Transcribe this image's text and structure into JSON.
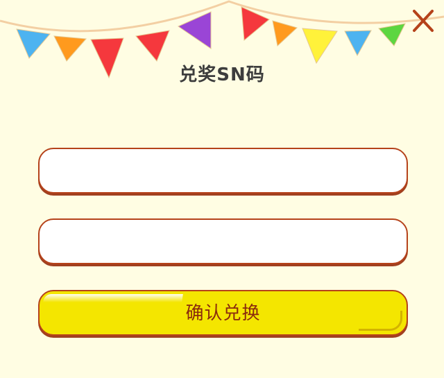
{
  "dialog": {
    "title": "兑奖SN码",
    "fields": [
      {
        "value": "",
        "placeholder": ""
      },
      {
        "value": "",
        "placeholder": ""
      }
    ],
    "confirm_label": "确认兑换",
    "close_icon": "close-icon"
  },
  "colors": {
    "background": "#fffde3",
    "border": "#b5421a",
    "button_fill": "#f4e600",
    "button_text": "#8a2a0d",
    "title_text": "#3d3d3d",
    "close_icon": "#b5421a"
  },
  "bunting": {
    "flag_colors": [
      "#4db3f0",
      "#ff9a1e",
      "#f5383d",
      "#f5383d",
      "#9a45d6",
      "#f5383d",
      "#ff9a1e",
      "#fff23a",
      "#4db3f0",
      "#5dd640"
    ]
  }
}
